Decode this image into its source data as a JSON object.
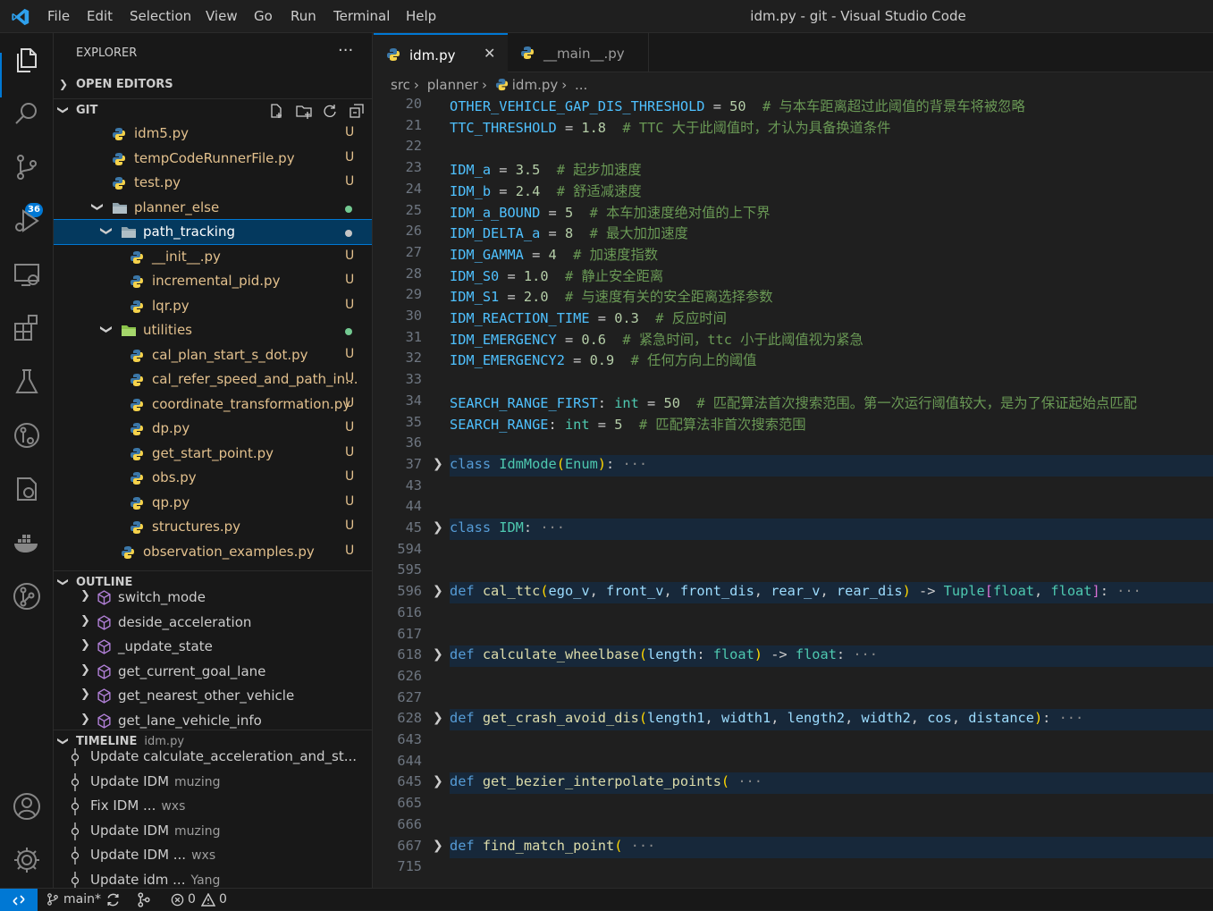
{
  "window": {
    "title": "idm.py - git - Visual Studio Code"
  },
  "menu": [
    "File",
    "Edit",
    "Selection",
    "View",
    "Go",
    "Run",
    "Terminal",
    "Help"
  ],
  "activity_bar": {
    "icons": [
      "explorer-icon",
      "search-icon",
      "source-control-icon",
      "run-debug-icon",
      "remote-explorer-icon",
      "extensions-icon",
      "testing-icon",
      "gitlens-icon",
      "git-graph-icon",
      "docker-icon",
      "git-branch-icon",
      "account-icon",
      "settings-gear-icon"
    ],
    "source_control_badge": "36"
  },
  "sidebar": {
    "title": "EXPLORER",
    "more": "···",
    "open_editors": "OPEN EDITORS",
    "folder": "GIT",
    "tree": [
      {
        "label": "idm5.py",
        "status": "U",
        "type": "py"
      },
      {
        "label": "tempCodeRunnerFile.py",
        "status": "U",
        "type": "py"
      },
      {
        "label": "test.py",
        "status": "U",
        "type": "py"
      },
      {
        "label": "planner_else",
        "status": "",
        "type": "folder"
      },
      {
        "label": "path_tracking",
        "status": "",
        "type": "folder-open"
      },
      {
        "label": "__init__.py",
        "status": "U",
        "type": "py"
      },
      {
        "label": "incremental_pid.py",
        "status": "U",
        "type": "py"
      },
      {
        "label": "lqr.py",
        "status": "U",
        "type": "py"
      },
      {
        "label": "utilities",
        "status": "",
        "type": "folder-open"
      },
      {
        "label": "cal_plan_start_s_dot.py",
        "status": "U",
        "type": "py"
      },
      {
        "label": "cal_refer_speed_and_path_in...",
        "status": "U",
        "type": "py"
      },
      {
        "label": "coordinate_transformation.py",
        "status": "U",
        "type": "py"
      },
      {
        "label": "dp.py",
        "status": "U",
        "type": "py"
      },
      {
        "label": "get_start_point.py",
        "status": "U",
        "type": "py"
      },
      {
        "label": "obs.py",
        "status": "U",
        "type": "py"
      },
      {
        "label": "qp.py",
        "status": "U",
        "type": "py"
      },
      {
        "label": "structures.py",
        "status": "U",
        "type": "py"
      },
      {
        "label": "observation_examples.py",
        "status": "U",
        "type": "py"
      }
    ],
    "outline_title": "OUTLINE",
    "outline": [
      "switch_mode",
      "deside_acceleration",
      "_update_state",
      "get_current_goal_lane",
      "get_nearest_other_vehicle",
      "get_lane_vehicle_info"
    ],
    "timeline_title": "TIMELINE",
    "timeline_file": "idm.py",
    "timeline": [
      {
        "msg": "Update calculate_acceleration_and_st...",
        "who": ""
      },
      {
        "msg": "Update IDM",
        "who": "muzing"
      },
      {
        "msg": "Fix IDM ...",
        "who": "wxs"
      },
      {
        "msg": "Update IDM",
        "who": "muzing"
      },
      {
        "msg": "Update IDM ...",
        "who": "wxs"
      },
      {
        "msg": "Update idm ...",
        "who": "Yang"
      }
    ]
  },
  "tabs": [
    {
      "label": "idm.py",
      "active": true,
      "close": "✕"
    },
    {
      "label": "__main__.py",
      "active": false
    }
  ],
  "breadcrumb": [
    "src",
    "planner",
    "idm.py",
    "..."
  ],
  "editor": {
    "lines": [
      {
        "n": "20",
        "v": "OTHER_VEHICLE_GAP_DIS_THRESHOLD",
        "eq": " = ",
        "num": "50",
        "cmt": "  # 与本车距离超过此阈值的背景车将被忽略"
      },
      {
        "n": "21",
        "v": "TTC_THRESHOLD",
        "eq": " = ",
        "num": "1.8",
        "cmt": "  # TTC 大于此阈值时，才认为具备换道条件"
      },
      {
        "n": "22"
      },
      {
        "n": "23",
        "v": "IDM_a",
        "eq": " = ",
        "num": "3.5",
        "cmt": "  # 起步加速度"
      },
      {
        "n": "24",
        "v": "IDM_b",
        "eq": " = ",
        "num": "2.4",
        "cmt": "  # 舒适减速度"
      },
      {
        "n": "25",
        "v": "IDM_a_BOUND",
        "eq": " = ",
        "num": "5",
        "cmt": "  # 本车加速度绝对值的上下界"
      },
      {
        "n": "26",
        "v": "IDM_DELTA_a",
        "eq": " = ",
        "num": "8",
        "cmt": "  # 最大加加速度"
      },
      {
        "n": "27",
        "v": "IDM_GAMMA",
        "eq": " = ",
        "num": "4",
        "cmt": "  # 加速度指数"
      },
      {
        "n": "28",
        "v": "IDM_S0",
        "eq": " = ",
        "num": "1.0",
        "cmt": "  # 静止安全距离"
      },
      {
        "n": "29",
        "v": "IDM_S1",
        "eq": " = ",
        "num": "2.0",
        "cmt": "  # 与速度有关的安全距离选择参数"
      },
      {
        "n": "30",
        "v": "IDM_REACTION_TIME",
        "eq": " = ",
        "num": "0.3",
        "cmt": "  # 反应时间"
      },
      {
        "n": "31",
        "v": "IDM_EMERGENCY",
        "eq": " = ",
        "num": "0.6",
        "cmt": "  # 紧急时间，ttc 小于此阈值视为紧急"
      },
      {
        "n": "32",
        "v": "IDM_EMERGENCY2",
        "eq": " = ",
        "num": "0.9",
        "cmt": "  # 任何方向上的阈值"
      },
      {
        "n": "33"
      },
      {
        "n": "34",
        "v": "SEARCH_RANGE_FIRST",
        "ty": ": int",
        "eq": " = ",
        "num": "50",
        "cmt": "  # 匹配算法首次搜索范围。第一次运行阈值较大，是为了保证起始点匹配"
      },
      {
        "n": "35",
        "v": "SEARCH_RANGE",
        "ty": ": int",
        "eq": " = ",
        "num": "5",
        "cmt": "  # 匹配算法非首次搜索范围"
      },
      {
        "n": "36"
      },
      {
        "n": "37",
        "kw": "class",
        "sig": [
          [
            "cl",
            "IdmMode"
          ],
          [
            "br",
            "("
          ],
          [
            "cl",
            "Enum"
          ],
          [
            "br",
            ")"
          ],
          [
            "x",
            ":"
          ]
        ],
        "folded": true
      },
      {
        "n": "43"
      },
      {
        "n": "44"
      },
      {
        "n": "45",
        "kw": "class",
        "sig": [
          [
            "cl",
            "IDM"
          ],
          [
            "x",
            ":"
          ]
        ],
        "folded": true
      },
      {
        "n": "594"
      },
      {
        "n": "595"
      },
      {
        "n": "596",
        "kw": "def",
        "sig": [
          [
            "f",
            "cal_ttc"
          ],
          [
            "br",
            "("
          ],
          [
            "p",
            "ego_v"
          ],
          [
            "x",
            ", "
          ],
          [
            "p",
            "front_v"
          ],
          [
            "x",
            ", "
          ],
          [
            "p",
            "front_dis"
          ],
          [
            "x",
            ", "
          ],
          [
            "p",
            "rear_v"
          ],
          [
            "x",
            ", "
          ],
          [
            "p",
            "rear_dis"
          ],
          [
            "br",
            ")"
          ],
          [
            "x",
            " -> "
          ],
          [
            "cl",
            "Tuple"
          ],
          [
            "br2",
            "["
          ],
          [
            "cl",
            "float"
          ],
          [
            "x",
            ", "
          ],
          [
            "cl",
            "float"
          ],
          [
            "br2",
            "]"
          ],
          [
            "x",
            ":"
          ]
        ],
        "folded": true
      },
      {
        "n": "616"
      },
      {
        "n": "617"
      },
      {
        "n": "618",
        "kw": "def",
        "sig": [
          [
            "f",
            "calculate_wheelbase"
          ],
          [
            "br",
            "("
          ],
          [
            "p",
            "length"
          ],
          [
            "x",
            ": "
          ],
          [
            "cl",
            "float"
          ],
          [
            "br",
            ")"
          ],
          [
            "x",
            " -> "
          ],
          [
            "cl",
            "float"
          ],
          [
            "x",
            ":"
          ]
        ],
        "folded": true
      },
      {
        "n": "626"
      },
      {
        "n": "627"
      },
      {
        "n": "628",
        "kw": "def",
        "sig": [
          [
            "f",
            "get_crash_avoid_dis"
          ],
          [
            "br",
            "("
          ],
          [
            "p",
            "length1"
          ],
          [
            "x",
            ", "
          ],
          [
            "p",
            "width1"
          ],
          [
            "x",
            ", "
          ],
          [
            "p",
            "length2"
          ],
          [
            "x",
            ", "
          ],
          [
            "p",
            "width2"
          ],
          [
            "x",
            ", "
          ],
          [
            "p",
            "cos"
          ],
          [
            "x",
            ", "
          ],
          [
            "p",
            "distance"
          ],
          [
            "br",
            ")"
          ],
          [
            "x",
            ":"
          ]
        ],
        "folded": true
      },
      {
        "n": "643"
      },
      {
        "n": "644"
      },
      {
        "n": "645",
        "kw": "def",
        "sig": [
          [
            "f",
            "get_bezier_interpolate_points"
          ],
          [
            "br",
            "("
          ]
        ],
        "folded": true
      },
      {
        "n": "665"
      },
      {
        "n": "666"
      },
      {
        "n": "667",
        "kw": "def",
        "sig": [
          [
            "f",
            "find_match_point"
          ],
          [
            "br",
            "("
          ]
        ],
        "folded": true
      },
      {
        "n": "715"
      }
    ],
    "ellipsis": "···"
  },
  "statusbar": {
    "branch": "main*",
    "errors": "0",
    "warnings": "0"
  }
}
